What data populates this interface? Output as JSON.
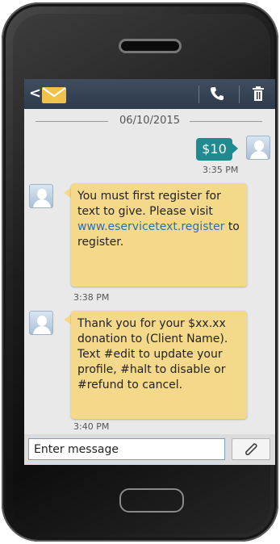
{
  "header": {
    "back_glyph": "<",
    "envelope_icon": "envelope-icon",
    "call_icon": "phone-icon",
    "delete_icon": "trash-icon"
  },
  "conversation": {
    "date": "06/10/2015",
    "messages": [
      {
        "direction": "outgoing",
        "text": "$10",
        "time": "3:35 PM",
        "color": "#1f8a8f"
      },
      {
        "direction": "incoming",
        "text_before_link": "You must first register for text to give. Please visit",
        "link": "www.eservicetext.register",
        "text_after_link": "to register.",
        "time": "3:38 PM",
        "color": "#f5d98a"
      },
      {
        "direction": "incoming",
        "text": "Thank you for your $xx.xx donation to (Client Name). Text #edit to update your profile, #halt to disable or #refund to cancel.",
        "time": "3:40 PM",
        "color": "#f5d98a"
      }
    ]
  },
  "composer": {
    "placeholder": "Enter message",
    "attach_icon": "paperclip-icon"
  }
}
